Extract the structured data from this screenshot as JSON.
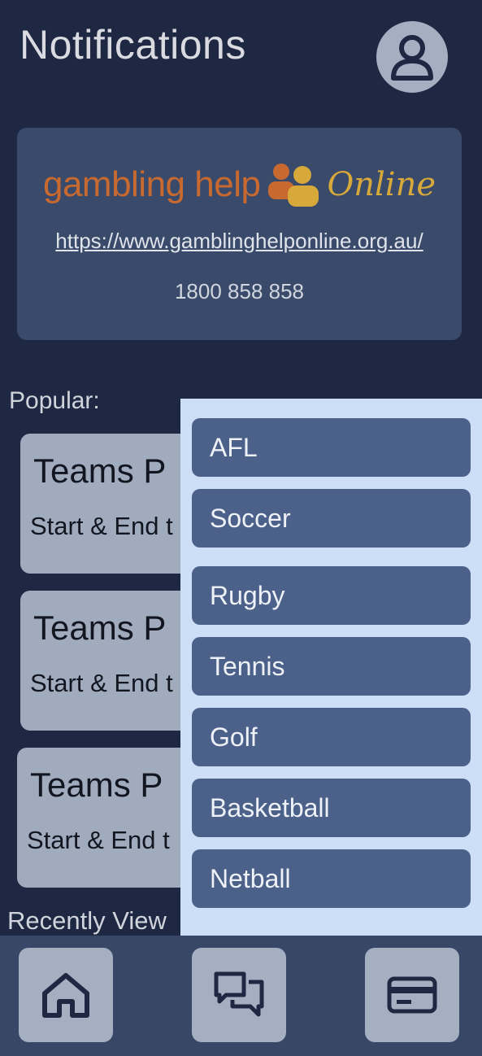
{
  "header": {
    "title": "Notifications",
    "avatar_icon": "user-icon"
  },
  "help": {
    "logo_text_gambling_help": "gambling help",
    "logo_text_online": "Online",
    "logo_icon": "people-icon",
    "link": "https://www.gamblinghelponline.org.au/",
    "phone": "1800 858 858"
  },
  "popular": {
    "label": "Popular:",
    "cards": [
      {
        "title": "Teams P",
        "subtitle": "Start & End t"
      },
      {
        "title": "Teams P",
        "subtitle": "Start & End t"
      },
      {
        "title": "Teams P",
        "subtitle": "Start & End t"
      }
    ]
  },
  "recent": {
    "label": "Recently View"
  },
  "dropdown": {
    "items": [
      "AFL",
      "Soccer",
      "Rugby",
      "Tennis",
      "Golf",
      "Basketball",
      "Netball"
    ]
  },
  "nav": {
    "home_icon": "home-icon",
    "chat_icon": "chat-icon",
    "card_icon": "credit-card-icon"
  },
  "colors": {
    "background": "#1f2842",
    "card": "#3a4a6a",
    "popular_card": "#a0abbe",
    "dropdown_bg": "#cddff7",
    "dropdown_item": "#4b618a",
    "bottom_bar": "#374765"
  }
}
